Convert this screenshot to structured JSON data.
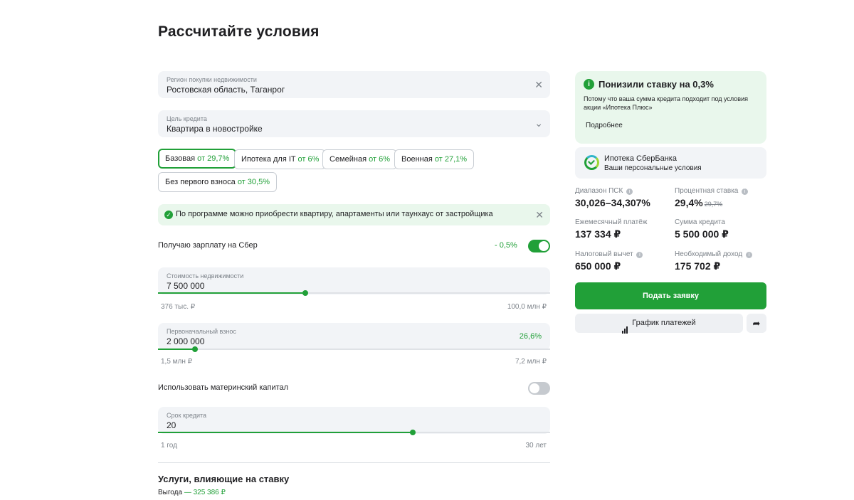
{
  "page_title": "Рассчитайте условия",
  "region": {
    "label": "Регион покупки недвижимости",
    "value": "Ростовская область, Таганрог"
  },
  "purpose": {
    "label": "Цель кредита",
    "value": "Квартира в новостройке"
  },
  "programs": [
    {
      "name": "Базовая",
      "rate": "от 29,7%"
    },
    {
      "name": "Ипотека для IT",
      "rate": "от 6%"
    },
    {
      "name": "Семейная",
      "rate": "от 6%"
    },
    {
      "name": "Военная",
      "rate": "от 27,1%"
    },
    {
      "name": "Без первого взноса",
      "rate": "от 30,5%"
    }
  ],
  "selected_program": "Базовая",
  "notice": {
    "text": "По программе можно приобрести квартиру, апартаменты или таунхаус от застройщика"
  },
  "salary": {
    "label": "Получаю зарплату на Сбер",
    "discount": "- 0,5%",
    "enabled": true
  },
  "property_cost": {
    "label": "Стоимость недвижимости",
    "value": "7 500 000",
    "min": "376 тыс. ₽",
    "max": "100,0 млн ₽",
    "fill": 0.376
  },
  "down_payment": {
    "label": "Первоначальный взнос",
    "value": "2 000 000",
    "percent": "26,6%",
    "min": "1,5 млн ₽",
    "max": "7,2 млн ₽",
    "fill": 0.095
  },
  "maternity_capital": {
    "label": "Использовать материнский капитал",
    "enabled": false
  },
  "term": {
    "label": "Срок кредита",
    "value": "20",
    "min": "1 год",
    "max": "30 лет",
    "fill": 0.65
  },
  "services": {
    "title": "Услуги, влияющие на ставку",
    "benefit_label": "Выгода",
    "benefit_value": "— 325 386 ₽"
  },
  "promo": {
    "title": "Понизили ставку на 0,3%",
    "text": "Потому что ваша сумма кредита подходит под условия акции «Ипотека Плюс»",
    "more": "Подробнее"
  },
  "product": {
    "name": "Ипотека СберБанка",
    "subtitle": "Ваши персональные условия"
  },
  "metrics": {
    "psk": {
      "label": "Диапазон ПСК",
      "value": "30,026–34,307%"
    },
    "rate": {
      "label": "Процентная ставка",
      "value": "29,4%",
      "old": "29,7%"
    },
    "monthly": {
      "label": "Ежемесячный платёж",
      "value": "137 334 ₽"
    },
    "loan": {
      "label": "Сумма кредита",
      "value": "5 500 000 ₽"
    },
    "tax": {
      "label": "Налоговый вычет",
      "value": "650 000 ₽"
    },
    "income": {
      "label": "Необходимый доход",
      "value": "175 702 ₽"
    }
  },
  "actions": {
    "apply": "Подать заявку",
    "schedule": "График платежей"
  },
  "colors": {
    "accent": "#21a038",
    "field_bg": "#f2f4f7",
    "notice_bg": "#e9f7ec"
  },
  "icons": {
    "close": "close-icon",
    "chevron": "chevron-down-icon",
    "info": "info-icon",
    "share": "share-icon",
    "chart": "bar-chart-icon"
  }
}
